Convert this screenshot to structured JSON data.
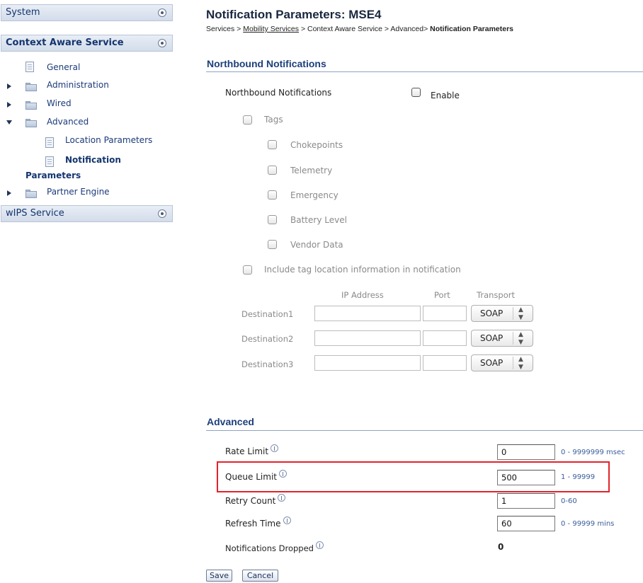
{
  "sidebar": {
    "system": "System",
    "context_aware": "Context Aware Service",
    "general": "General",
    "administration": "Administration",
    "wired": "Wired",
    "advanced": "Advanced",
    "location_parameters": "Location Parameters",
    "notification_line1": "Notification",
    "notification_line2": "Parameters",
    "partner_engine": "Partner Engine",
    "wips": "wIPS Service"
  },
  "page": {
    "title": "Notification Parameters: MSE4",
    "breadcrumb": {
      "services": "Services >",
      "mobility": "Mobility Services",
      "middle": "> Context Aware Service > Advanced>",
      "current": "Notification Parameters"
    }
  },
  "northbound": {
    "section_title": "Northbound Notifications",
    "label": "Northbound Notifications",
    "enable": "Enable",
    "tags": "Tags",
    "chokepoints": "Chokepoints",
    "telemetry": "Telemetry",
    "emergency": "Emergency",
    "battery": "Battery Level",
    "vendor": "Vendor Data",
    "include_tag": "Include tag location information in notification",
    "col_ip": "IP Address",
    "col_port": "Port",
    "col_transport": "Transport",
    "destinations": [
      {
        "label": "Destination1",
        "transport": "SOAP"
      },
      {
        "label": "Destination2",
        "transport": "SOAP"
      },
      {
        "label": "Destination3",
        "transport": "SOAP"
      }
    ]
  },
  "advanced": {
    "section_title": "Advanced",
    "rate_limit": {
      "label": "Rate Limit",
      "value": "0",
      "range": "0 - 9999999 msec"
    },
    "queue_limit": {
      "label": "Queue Limit",
      "value": "500",
      "range": "1 - 99999"
    },
    "retry_count": {
      "label": "Retry Count",
      "value": "1",
      "range": "0-60"
    },
    "refresh_time": {
      "label": "Refresh Time",
      "value": "60",
      "range": "0 - 99999 mins"
    },
    "dropped": {
      "label": "Notifications Dropped",
      "value": "0"
    }
  },
  "buttons": {
    "save": "Save",
    "cancel": "Cancel"
  },
  "colors": {
    "highlight": "#e4222b",
    "link": "#1d3f7a"
  }
}
